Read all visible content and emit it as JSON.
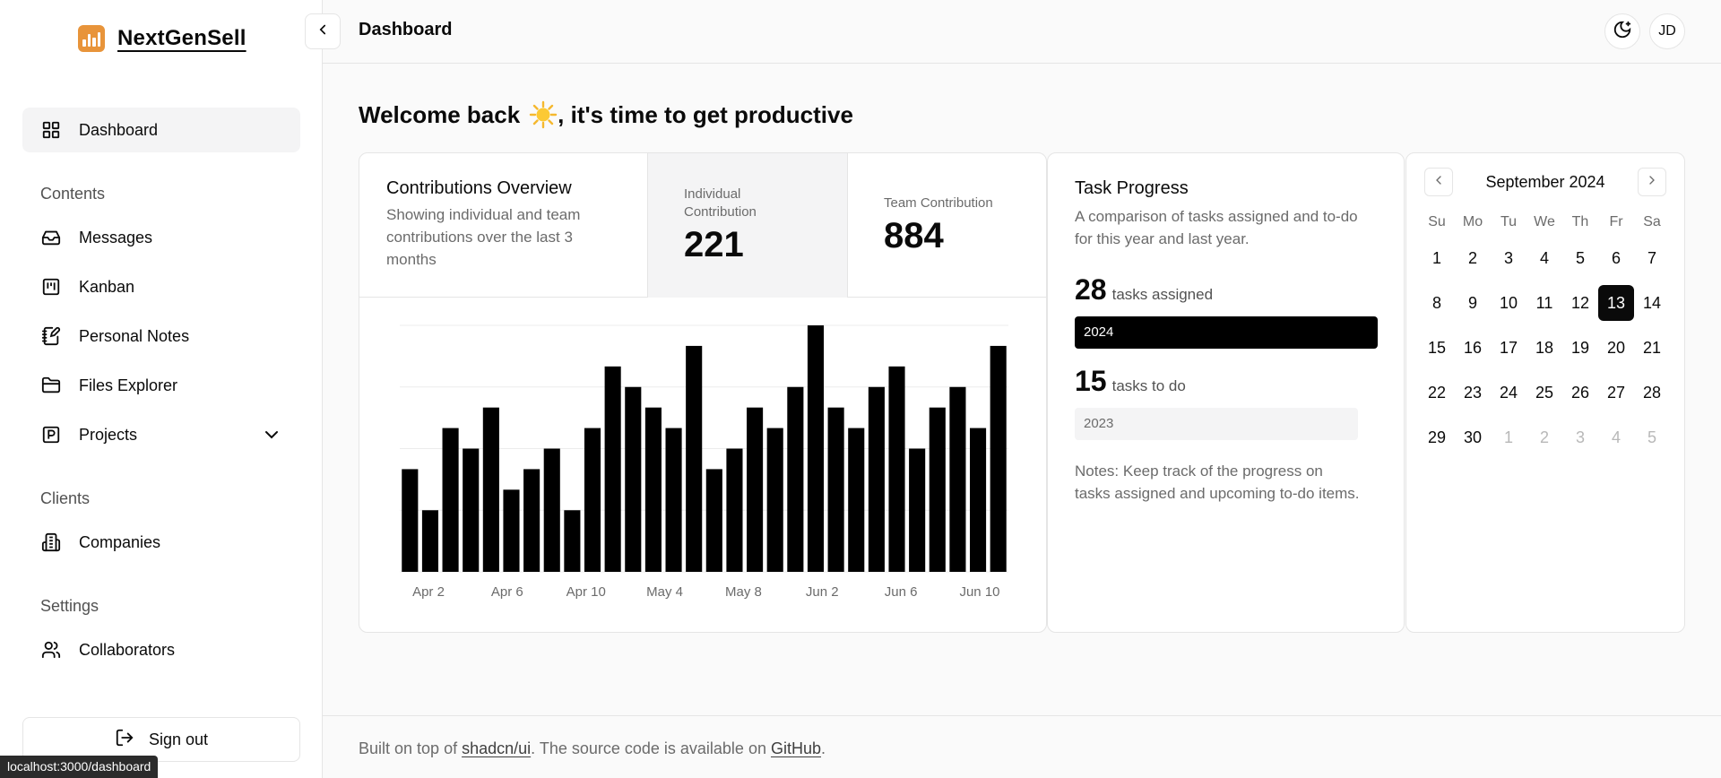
{
  "url_status": "localhost:3000/dashboard",
  "brand": {
    "name": "NextGenSell"
  },
  "sidebar": {
    "main_item": {
      "label": "Dashboard",
      "icon": "grid-icon"
    },
    "sections": [
      {
        "label": "Contents"
      },
      {
        "label": "Clients"
      },
      {
        "label": "Settings"
      }
    ],
    "items": [
      {
        "label": "Messages",
        "icon": "inbox-icon"
      },
      {
        "label": "Kanban",
        "icon": "kanban-icon"
      },
      {
        "label": "Personal Notes",
        "icon": "notebook-pen-icon"
      },
      {
        "label": "Files Explorer",
        "icon": "folder-icon"
      },
      {
        "label": "Projects",
        "icon": "square-p-icon"
      },
      {
        "label": "Companies",
        "icon": "building-icon"
      },
      {
        "label": "Collaborators",
        "icon": "users-icon"
      }
    ],
    "sign_out": "Sign out"
  },
  "header": {
    "title": "Dashboard",
    "avatar": "JD"
  },
  "welcome": {
    "before": "Welcome back",
    "after": ", it's time to get productive"
  },
  "contributions": {
    "title": "Contributions Overview",
    "description": "Showing individual and team contributions over the last 3 months",
    "individual_label": "Individual Contribution",
    "individual_value": "221",
    "team_label": "Team Contribution",
    "team_value": "884"
  },
  "chart_data": {
    "type": "bar",
    "x_ticks": [
      "Apr 2",
      "Apr 6",
      "Apr 10",
      "May 4",
      "May 8",
      "Jun 2",
      "Jun 6",
      "Jun 10"
    ],
    "ylim": [
      0,
      12
    ],
    "grid": true,
    "values": [
      5,
      3,
      7,
      6,
      8,
      4,
      5,
      6,
      3,
      7,
      10,
      9,
      8,
      7,
      11,
      5,
      6,
      8,
      7,
      9,
      12,
      8,
      7,
      9,
      10,
      6,
      8,
      9,
      7,
      11
    ]
  },
  "task": {
    "title": "Task Progress",
    "description": "A comparison of tasks assigned and to-do for this year and last year.",
    "assigned_count": "28",
    "assigned_label": "tasks assigned",
    "assigned_year": "2024",
    "todo_count": "15",
    "todo_label": "tasks to do",
    "todo_year": "2023",
    "notes": "Notes: Keep track of the progress on tasks assigned and upcoming to-do items."
  },
  "calendar": {
    "month": "September 2024",
    "weekdays": [
      "Su",
      "Mo",
      "Tu",
      "We",
      "Th",
      "Fr",
      "Sa"
    ],
    "weeks": [
      [
        "1",
        "2",
        "3",
        "4",
        "5",
        "6",
        "7"
      ],
      [
        "8",
        "9",
        "10",
        "11",
        "12",
        "13",
        "14"
      ],
      [
        "15",
        "16",
        "17",
        "18",
        "19",
        "20",
        "21"
      ],
      [
        "22",
        "23",
        "24",
        "25",
        "26",
        "27",
        "28"
      ],
      [
        "29",
        "30",
        "1",
        "2",
        "3",
        "4",
        "5"
      ]
    ],
    "selected": "13"
  },
  "footer": {
    "prefix": "Built on top of ",
    "link1": "shadcn/ui",
    "middle": ". The source code is available on ",
    "link2": "GitHub",
    "suffix": "."
  }
}
